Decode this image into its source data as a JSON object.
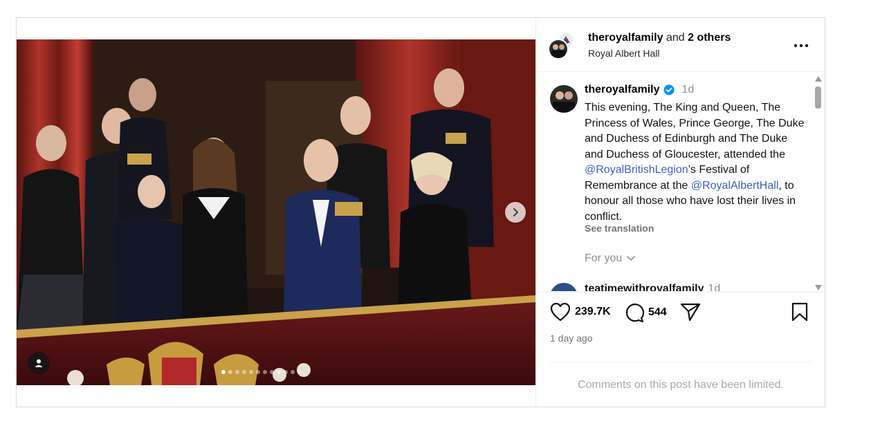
{
  "header": {
    "username": "theroyalfamily",
    "and_text": "and",
    "others": "2 others",
    "location": "Royal Albert Hall"
  },
  "caption": {
    "username": "theroyalfamily",
    "time": "1d",
    "text_1": "This evening, The King and Queen, The Princess of Wales, Prince George, The Duke and Duchess of Edinburgh and The Duke and Duchess of Gloucester, attended the ",
    "mention_1": "@RoyalBritishLegion",
    "text_2": "’s Festival of Remembrance at the ",
    "mention_2": "@RoyalAlbertHall",
    "text_3": ", to honour all those who have lost their lives in conflict.",
    "see_translation": "See translation"
  },
  "for_you": "For you",
  "next_comment": {
    "username": "teatimewithroyalfamily",
    "time": "1d"
  },
  "actions": {
    "likes": "239.7K",
    "comments": "544"
  },
  "posted": "1 day ago",
  "comments_limited": "Comments on this post have been limited.",
  "carousel": {
    "total": 12,
    "current": 1
  },
  "icons": {
    "like": "heart-icon",
    "comment": "comment-bubble-icon",
    "share": "paper-plane-icon",
    "save": "bookmark-icon",
    "more": "more-horizontal-icon",
    "next": "chevron-right-icon",
    "tag": "user-tag-icon",
    "verified": "verified-badge-icon"
  },
  "colors": {
    "mention": "#3b5fc0",
    "verified": "#0095f6",
    "muted": "#8e8e8e"
  }
}
